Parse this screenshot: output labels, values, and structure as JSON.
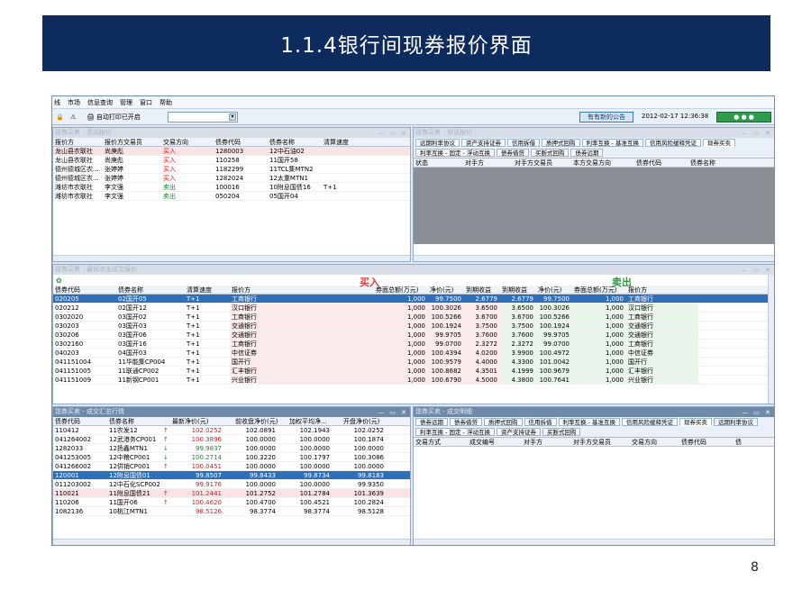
{
  "slide": {
    "title": "1.1.4银行间现券报价界面",
    "page": "8"
  },
  "menu": [
    "线",
    "市场",
    "信息查询",
    "管理",
    "窗口",
    "帮助"
  ],
  "toolbar": {
    "print": "自动打印已开启",
    "notice": "有有新的公告",
    "clock": "2012-02-17 12:36:38"
  },
  "quote_panel": {
    "title": "现券买卖 - 意向报价",
    "headers": [
      "报价方",
      "报价方交易员",
      "交易方向",
      "债券代码",
      "债券名称",
      "清算速度"
    ],
    "rows": [
      [
        "龙山县农联社",
        "尚庚彪",
        "买入",
        "1280003",
        "12中石油02",
        ""
      ],
      [
        "龙山县农联社",
        "尚庚彪",
        "买入",
        "110258",
        "11国开58",
        ""
      ],
      [
        "德州德城区农...",
        "张婷婷",
        "买入",
        "1182299",
        "11TCL集MTN2",
        ""
      ],
      [
        "德州德城区农...",
        "张婷婷",
        "买入",
        "1282024",
        "12太重MTN1",
        ""
      ],
      [
        "潍坊市农联社",
        "李文强",
        "卖出",
        "100016",
        "10附息国债16",
        "T+1"
      ],
      [
        "潍坊市农联社",
        "李文强",
        "卖出",
        "050204",
        "05国开04",
        ""
      ]
    ]
  },
  "dialog_panel": {
    "title": "现券买卖 - 对话报价",
    "tabs": [
      "远期利率协议",
      "资产支持证券",
      "信用拆借",
      "质押式回购",
      "利率互换 - 基准互换",
      "信用风险缓释凭证",
      "现券买卖",
      "利率互换 - 固定 - 浮动互换",
      "债券借贷",
      "买断式回购",
      "债券远期"
    ],
    "headers": [
      "状态",
      "对手方",
      "对手方交易员",
      "本方交易方向",
      "债券代码",
      "债券名称"
    ]
  },
  "best_panel": {
    "title": "现券买卖 - 最优点击成交报价",
    "buy_label": "买入",
    "sell_label": "卖出",
    "headers": [
      "债券代码",
      "债券名称",
      "清算速度",
      "报价方",
      "券面总额(万元)",
      "净价(元)",
      "到期收益",
      "到期收益",
      "净价(元)",
      "券面总额(万元)",
      "报价方"
    ],
    "rows": [
      [
        "020205",
        "02国开05",
        "T+1",
        "工商银行",
        "1,000",
        "99.7500",
        "2.6779",
        "2.6779",
        "99.7500",
        "1,000",
        "工商银行"
      ],
      [
        "020212",
        "02国开12",
        "T+1",
        "汉口银行",
        "1,000",
        "100.3026",
        "3.6500",
        "3.6500",
        "100.3026",
        "1,000",
        "汉口银行"
      ],
      [
        "0302020",
        "03国开02",
        "T+1",
        "工商银行",
        "1,000",
        "100.5266",
        "3.6700",
        "3.6700",
        "100.5266",
        "1,000",
        "工商银行"
      ],
      [
        "030203",
        "03国开03",
        "T+1",
        "交通银行",
        "1,000",
        "100.1924",
        "3.7500",
        "3.7500",
        "100.1924",
        "1,000",
        "交通银行"
      ],
      [
        "030206",
        "03国开06",
        "T+1",
        "交通银行",
        "1,000",
        "99.9705",
        "3.7600",
        "3.7600",
        "99.9705",
        "1,000",
        "交通银行"
      ],
      [
        "0302160",
        "03国开16",
        "T+1",
        "工商银行",
        "1,000",
        "99.0700",
        "2.3272",
        "2.3272",
        "99.0700",
        "1,000",
        "工商银行"
      ],
      [
        "040203",
        "04国开03",
        "T+1",
        "中信证券",
        "1,000",
        "100.4394",
        "4.0200",
        "3.9900",
        "100.4972",
        "1,000",
        "中信证券"
      ],
      [
        "041151004",
        "11华能集CP004",
        "T+1",
        "国开行",
        "1,000",
        "100.9579",
        "4.4000",
        "4.3300",
        "101.0042",
        "1,000",
        "国开行"
      ],
      [
        "041151005",
        "11联通CP002",
        "T+1",
        "汇丰银行",
        "1,000",
        "100.8682",
        "4.3501",
        "4.1999",
        "100.9679",
        "1,000",
        "汇丰银行"
      ],
      [
        "041151009",
        "11新钢CP001",
        "T+1",
        "兴业银行",
        "1,000",
        "100.6790",
        "4.5000",
        "4.3800",
        "100.7641",
        "1,000",
        "兴业银行"
      ]
    ]
  },
  "trade_panel": {
    "title": "现券买卖 - 成交汇总行情",
    "headers": [
      "债券代码",
      "债券名称",
      "最新净价(元)",
      "前收盘净价(元)",
      "加权平均净...",
      "开盘净价(元)"
    ],
    "rows": [
      [
        "110412",
        "11农发12",
        "↑",
        "102.0252",
        "102.0891",
        "102.1943",
        "102.0252"
      ],
      [
        "041264002",
        "12武港务CP001",
        "↑",
        "100.3896",
        "100.0000",
        "100.0000",
        "100.1874"
      ],
      [
        "1282033",
        "12扬鑫MTN1",
        "↓",
        "99.9837",
        "100.0000",
        "100.0000",
        "100.0000"
      ],
      [
        "041253005",
        "12中粮CP001",
        "↓",
        "100.2714",
        "100.3220",
        "100.1797",
        "100.3086"
      ],
      [
        "041266002",
        "12供销CP001",
        "↑",
        "100.0451",
        "100.0000",
        "100.0000",
        "100.0000"
      ],
      [
        "120001",
        "12附息国债01",
        "",
        "99.8507",
        "99.8433",
        "99.8734",
        "99.8183"
      ],
      [
        "011203002",
        "12中石化SCP002",
        "",
        "99.9176",
        "100.0000",
        "100.0000",
        "99.9350"
      ],
      [
        "110021",
        "11附息国债21",
        "↑",
        "101.2441",
        "101.2752",
        "101.2784",
        "101.3639"
      ],
      [
        "110206",
        "11国开06",
        "↑",
        "100.4620",
        "100.4700",
        "100.4521",
        "100.2824"
      ],
      [
        "1082136",
        "10桃江MTN1",
        "",
        "98.5126",
        "98.3774",
        "98.3774",
        "98.5128"
      ]
    ]
  },
  "detail_panel": {
    "title": "现券买卖 - 成交明细",
    "tabs": [
      "债券远期",
      "债券借贷",
      "质押式回购",
      "信用拆借",
      "利率互换 - 基准互换",
      "信用风险缓释凭证",
      "现券买卖",
      "远期利率协议",
      "利率互换 - 固定 - 浮动互换",
      "资产支持证券",
      "买断式回购"
    ],
    "headers": [
      "交易方式",
      "成交编号",
      "对手方",
      "对手方交易员",
      "交易方向",
      "债券代码",
      "债"
    ]
  }
}
